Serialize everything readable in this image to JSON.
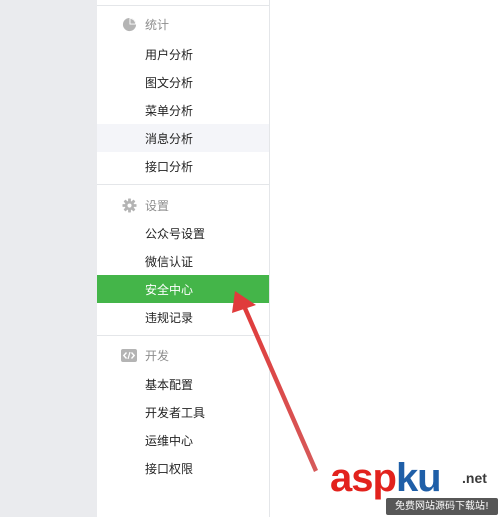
{
  "sidebar": {
    "sections": [
      {
        "title": "统计",
        "icon": "pie-chart-icon",
        "items": [
          "用户分析",
          "图文分析",
          "菜单分析",
          "消息分析",
          "接口分析"
        ]
      },
      {
        "title": "设置",
        "icon": "gear-icon",
        "items": [
          "公众号设置",
          "微信认证",
          "安全中心",
          "违规记录"
        ]
      },
      {
        "title": "开发",
        "icon": "code-icon",
        "items": [
          "基本配置",
          "开发者工具",
          "运维中心",
          "接口权限"
        ]
      }
    ],
    "hovered_item": "消息分析",
    "active_item": "安全中心"
  },
  "colors": {
    "active": "#44b549",
    "hover": "#f4f5f9",
    "arrow": "#e03b3b",
    "gutter": "#eaebee"
  },
  "watermark": {
    "logo_part1": "asp",
    "logo_part2": "ku",
    "suffix": ".net",
    "tagline": "免费网站源码下载站!"
  }
}
